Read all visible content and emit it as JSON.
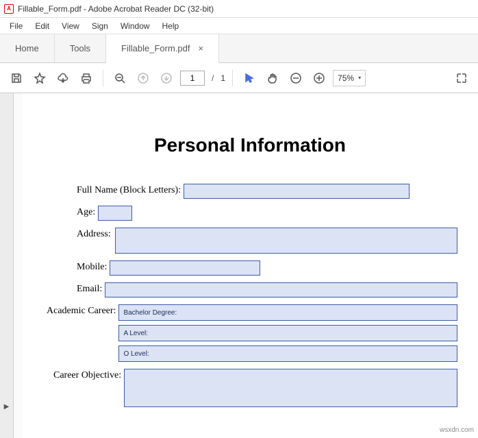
{
  "window": {
    "title": "Fillable_Form.pdf - Adobe Acrobat Reader DC (32-bit)",
    "app_icon_char": "A"
  },
  "menubar": [
    "File",
    "Edit",
    "View",
    "Sign",
    "Window",
    "Help"
  ],
  "tabs": {
    "home": "Home",
    "tools": "Tools",
    "doc": "Fillable_Form.pdf"
  },
  "toolbar": {
    "page_current": "1",
    "page_total": "1",
    "zoom": "75%"
  },
  "doc": {
    "heading": "Personal Information",
    "labels": {
      "fullname": "Full Name (Block Letters):",
      "age": "Age:",
      "address": "Address:",
      "mobile": "Mobile:",
      "email": "Email:",
      "academic": "Academic Career:",
      "objective": "Career Objective:"
    },
    "academic_levels": [
      "Bachelor Degree:",
      "A Level:",
      "O Level:"
    ]
  },
  "watermark": "wsxdn.com"
}
